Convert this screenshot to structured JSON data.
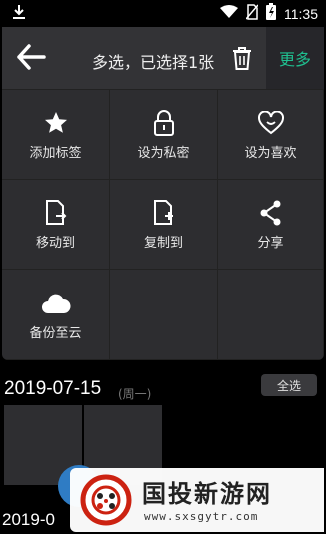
{
  "status_bar": {
    "time": "11:35",
    "icons": [
      "download-icon",
      "wifi-icon",
      "no-sim-icon",
      "battery-charging-icon"
    ]
  },
  "header": {
    "title": "多选，已选择1张",
    "more_label": "更多"
  },
  "actions": [
    {
      "label": "添加标签",
      "icon": "star-icon"
    },
    {
      "label": "设为私密",
      "icon": "lock-icon"
    },
    {
      "label": "设为喜欢",
      "icon": "heart-icon"
    },
    {
      "label": "移动到",
      "icon": "move-file-icon"
    },
    {
      "label": "复制到",
      "icon": "copy-file-icon"
    },
    {
      "label": "分享",
      "icon": "share-icon"
    },
    {
      "label": "备份至云",
      "icon": "cloud-icon"
    }
  ],
  "gallery": {
    "section_date": "2019-07-15",
    "section_weekday": "(周一)",
    "select_all_label": "全选",
    "next_section_date_partial": "2019-0"
  },
  "watermark": {
    "title": "国投新游网",
    "url": "www.sxsgytr.com"
  }
}
